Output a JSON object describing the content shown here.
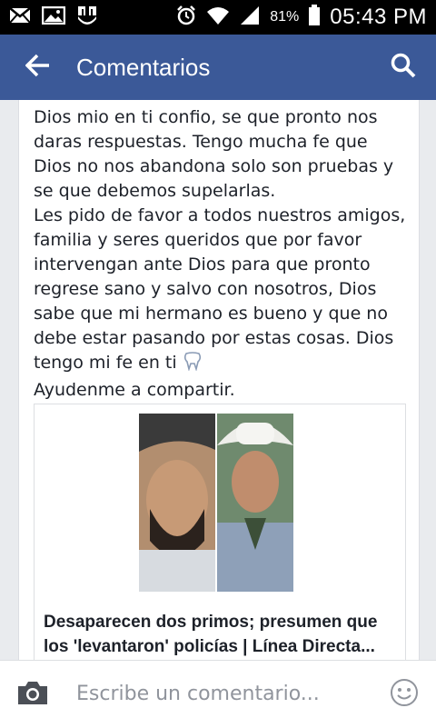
{
  "status_bar": {
    "battery_percent": "81%",
    "time": "05:43 PM",
    "icons": [
      "mail-icon",
      "image-icon",
      "univision-icon",
      "alarm-icon",
      "wifi-icon",
      "signal-icon",
      "battery-icon"
    ]
  },
  "app_bar": {
    "title": "Comentarios",
    "background_color": "#3b5998",
    "icons": [
      "back-arrow-icon",
      "search-icon"
    ]
  },
  "post": {
    "text": "Dios mio en ti confio, se que pronto nos daras respuestas. Tengo mucha fe que Dios no nos abandona solo son pruebas y se que debemos supelarlas.\nLes pido de favor a todos nuestros amigos, familia y seres queridos que por favor intervengan ante Dios para que pronto regrese sano y salvo con nosotros, Dios sabe que mi hermano es bueno y que no debe estar pasando por estas cosas. Dios tengo mi fe en ti",
    "emoji": "tooth-icon",
    "text_end": "Ayudenme a compartir.",
    "link": {
      "title": "Desaparecen dos primos; presumen que los 'levantaron' policías | Línea Directa..."
    }
  },
  "composer": {
    "placeholder": "Escribe un comentario...",
    "icons": [
      "camera-icon",
      "smiley-icon"
    ]
  }
}
